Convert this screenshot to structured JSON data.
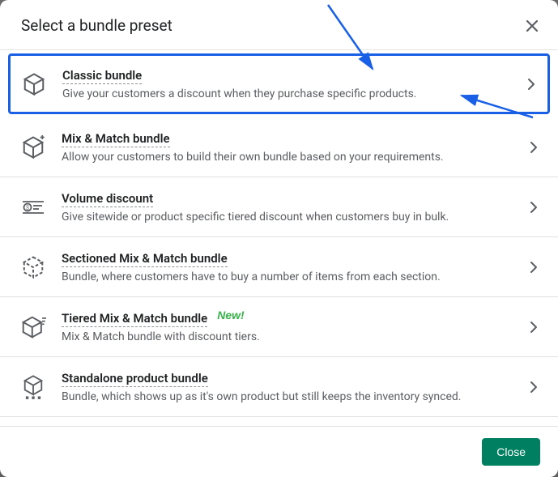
{
  "modal": {
    "title": "Select a bundle preset",
    "close_label": "Close"
  },
  "options": [
    {
      "title": "Classic bundle",
      "desc": "Give your customers a discount when they purchase specific products.",
      "highlight": true
    },
    {
      "title": "Mix & Match bundle",
      "desc": "Allow your customers to build their own bundle based on your requirements."
    },
    {
      "title": "Volume discount",
      "desc": "Give sitewide or product specific tiered discount when customers buy in bulk."
    },
    {
      "title": "Sectioned Mix & Match bundle",
      "desc": "Bundle, where customers have to buy a number of items from each section."
    },
    {
      "title": "Tiered Mix & Match bundle",
      "desc": "Mix & Match bundle with discount tiers.",
      "new_tag": "New!"
    },
    {
      "title": "Standalone product bundle",
      "desc": "Bundle, which shows up as it's own product but still keeps the inventory synced."
    }
  ]
}
